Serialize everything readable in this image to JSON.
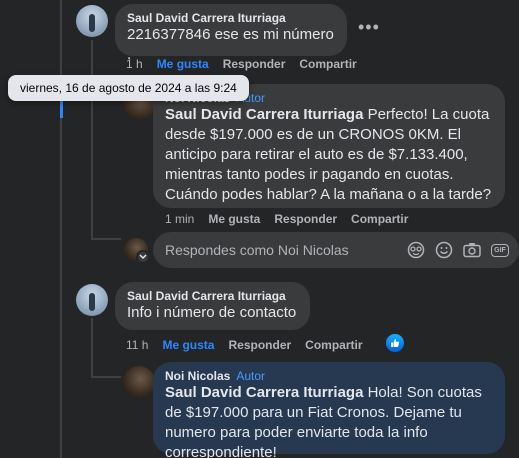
{
  "comment1": {
    "author": "Saul David Carrera Iturriaga",
    "text": "2216377846 ese es mi número .",
    "time": "1 h",
    "like": "Me gusta",
    "reply": "Responder",
    "share": "Compartir"
  },
  "tooltip": "viernes, 16 de agosto de 2024 a las 9:24",
  "reply1": {
    "author": "Noi Nicolas",
    "badge": "Autor",
    "mention": "Saul David Carrera Iturriaga",
    "text": " Perfecto! La cuota desde $197.000 es de un CRONOS 0KM. El anticipo para retirar el auto es de $7.133.400, mientras tanto podes ir pagando en cuotas. Cuándo podes hablar? A la mañana o a la tarde?",
    "time": "1 min",
    "like": "Me gusta",
    "reply": "Responder",
    "share": "Compartir"
  },
  "composer": {
    "placeholder": "Respondes como Noi Nicolas",
    "icons": [
      "sticker-icon",
      "emoji-icon",
      "camera-icon",
      "gif-icon"
    ],
    "gif": "GIF"
  },
  "comment2": {
    "author": "Saul David Carrera Iturriaga",
    "text": "Info i número de contacto",
    "time": "11 h",
    "like": "Me gusta",
    "reply": "Responder",
    "share": "Compartir"
  },
  "reply2": {
    "author": "Noi Nicolas",
    "badge": "Autor",
    "mention": "Saul David Carrera Iturriaga",
    "text": " Hola! Son cuotas de $197.000 para un Fiat Cronos. Dejame tu numero para poder enviarte toda la info correspondiente!"
  },
  "colors": {
    "background": "#242526",
    "bubble": "#3a3b3c",
    "highlight": "#263951",
    "link": "#2d88ff",
    "badge": "#4599ff"
  }
}
